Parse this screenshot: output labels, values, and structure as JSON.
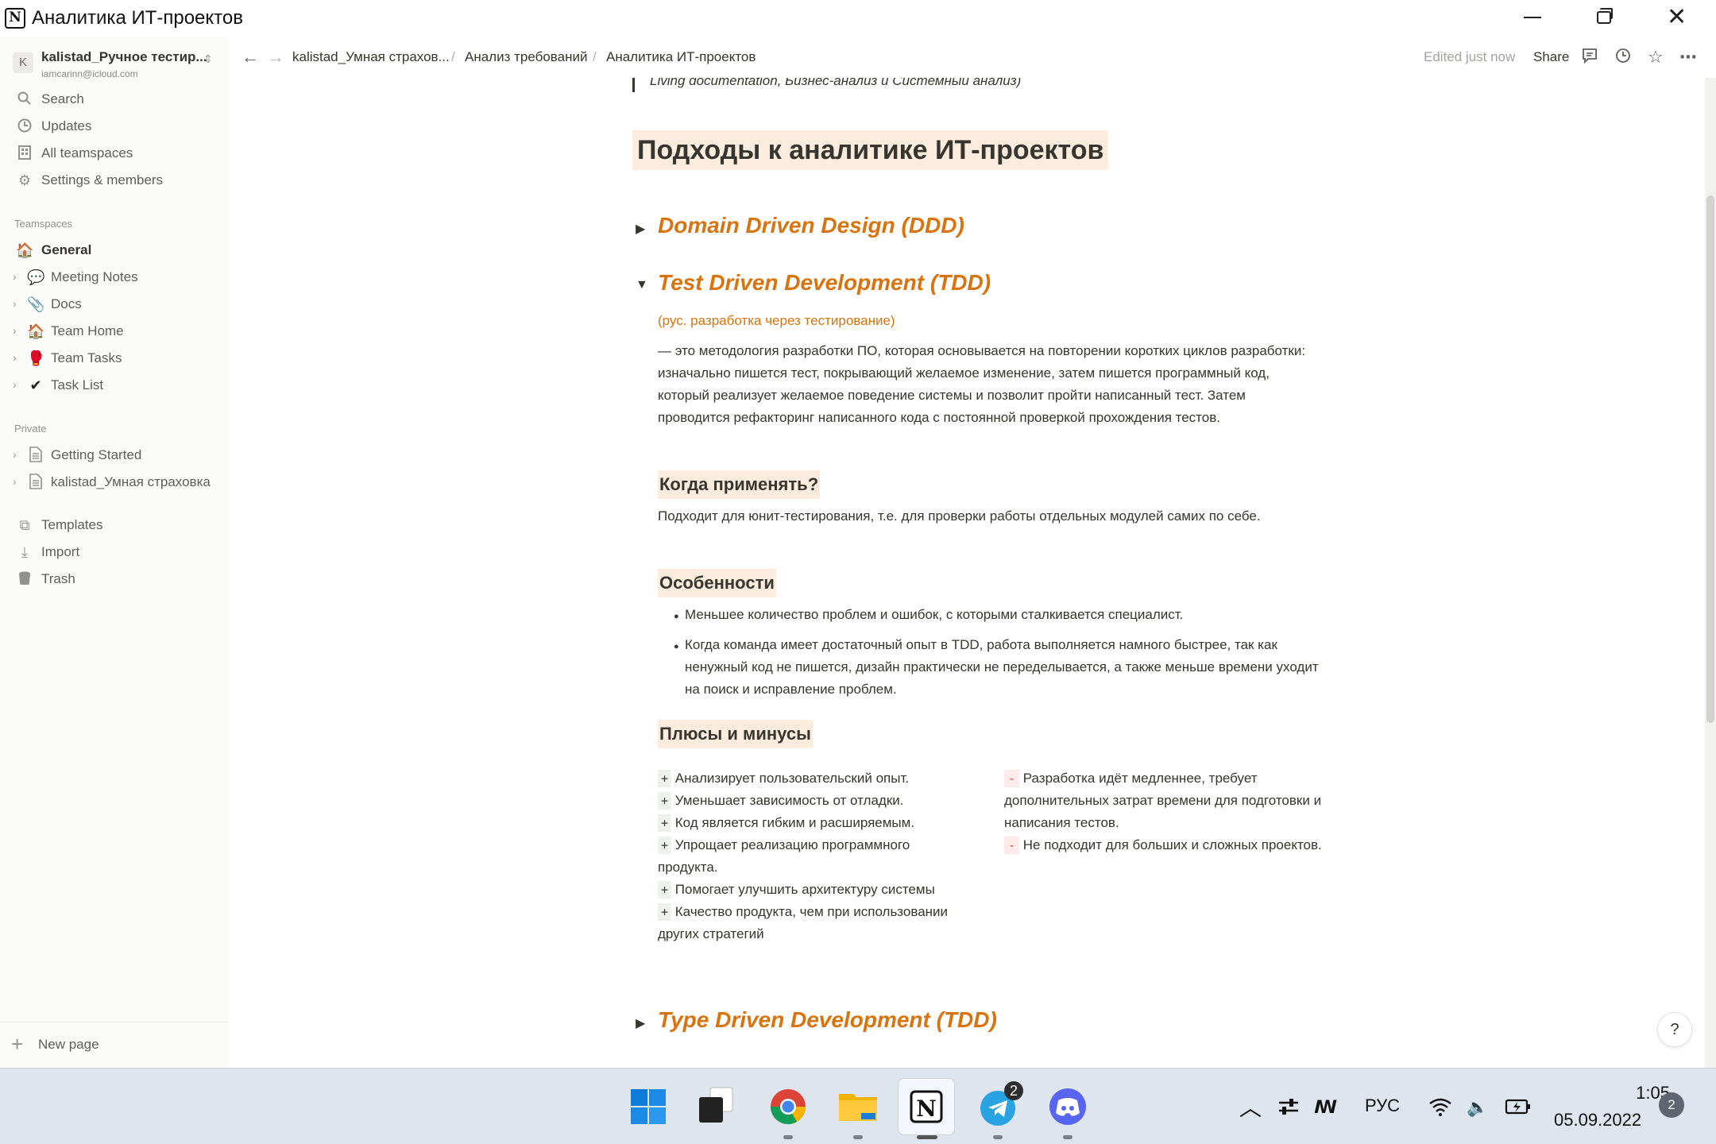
{
  "window": {
    "title": "Аналитика ИТ-проектов",
    "logo": "N",
    "close_glyph": "✕"
  },
  "sidebar": {
    "workspace": {
      "avatar": "K",
      "name": "kalistad_Ручное тестир...",
      "email": "iamcarinn@icloud.com"
    },
    "nav": [
      {
        "label": "Search",
        "icon": "search-icon"
      },
      {
        "label": "Updates",
        "icon": "clock-icon"
      },
      {
        "label": "All teamspaces",
        "icon": "building-icon"
      },
      {
        "label": "Settings & members",
        "icon": "gear-icon"
      }
    ],
    "teamspaces_label": "Teamspaces",
    "teamspaces": [
      {
        "label": "General",
        "icon": "🏠"
      },
      {
        "label": "Meeting Notes",
        "icon": "💬"
      },
      {
        "label": "Docs",
        "icon": "📎"
      },
      {
        "label": "Team Home",
        "icon": "🏠"
      },
      {
        "label": "Team Tasks",
        "icon": "🥊"
      },
      {
        "label": "Task List",
        "icon": "✔"
      }
    ],
    "private_label": "Private",
    "private": [
      {
        "label": "Getting Started",
        "icon": "page-icon"
      },
      {
        "label": "kalistad_Умная страховка",
        "icon": "page-icon"
      }
    ],
    "bottom_nav": [
      {
        "label": "Templates",
        "icon": "templates-icon"
      },
      {
        "label": "Import",
        "icon": "import-icon"
      },
      {
        "label": "Trash",
        "icon": "trash-icon"
      }
    ],
    "new_page": "New page"
  },
  "topbar": {
    "breadcrumbs": [
      "kalistad_Умная страхов...",
      "Анализ требований",
      "Аналитика ИТ-проектов"
    ],
    "separator": "/",
    "edited": "Edited just now",
    "share": "Share"
  },
  "doc": {
    "quote_fragment": "Living documentation, Бизнес-анализ и Системный анализ)",
    "heading": "Подходы к аналитике ИТ-проектов",
    "toggles": [
      {
        "title": "Domain Driven Design (DDD)",
        "open": false
      },
      {
        "title": "Test Driven Development (TDD)",
        "open": true
      },
      {
        "title": "Type Driven Development (TDD)",
        "open": false
      }
    ],
    "tdd": {
      "subtitle": "(рус. разработка через тестирование)",
      "description": "— это методология разработки ПО, которая основывается на повторении коротких циклов разработки: изначально пишется тест, покрывающий желаемое изменение, затем пишется программный код, который реализует желаемое поведение системы и позволит пройти написанный тест. Затем проводится рефакторинг написанного кода с постоянной проверкой прохождения тестов.",
      "when_heading": "Когда применять?",
      "when_text": "Подходит для юнит-тестирования, т.е. для проверки работы отдельных модулей самих по себе.",
      "features_heading": "Особенности",
      "features": [
        "Меньшее количество проблем и ошибок, с которыми сталкивается специалист.",
        "Когда команда имеет достаточный опыт в TDD, работа выполняется намного быстрее, так как ненужный код не пишется, дизайн практически не переделывается, а также меньше времени уходит на поиск и исправление проблем."
      ],
      "pros_cons_heading": "Плюсы и минусы",
      "plus_mark": "+",
      "minus_mark": "-",
      "pros": [
        "Анализирует пользовательский опыт.",
        "Уменьшает зависимость от отладки.",
        "Код является гибким и расширяемым.",
        "Упрощает реализацию программного продукта.",
        "Помогает улучшить архитектуру системы",
        "Качество продукта, чем при использовании других стратегий"
      ],
      "cons": [
        "Разработка идёт медленнее, требует дополнительных затрат времени для подготовки и написания тестов.",
        "Не подходит для больших и сложных проектов."
      ]
    },
    "help": "?"
  },
  "taskbar": {
    "apps": [
      {
        "name": "windows-start"
      },
      {
        "name": "task-view"
      },
      {
        "name": "chrome"
      },
      {
        "name": "file-explorer"
      },
      {
        "name": "notion"
      },
      {
        "name": "telegram",
        "badge": "2"
      },
      {
        "name": "discord"
      }
    ],
    "language": "РУС",
    "time": "1:05",
    "date": "05.09.2022",
    "notifications": "2"
  },
  "colors": {
    "accent_orange": "#d9730d",
    "highlight_bg": "#fbecdd"
  }
}
